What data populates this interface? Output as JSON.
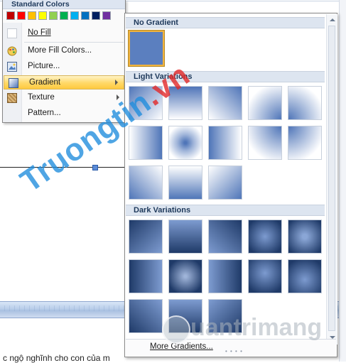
{
  "fill_menu": {
    "standard_colors_title": "Standard Colors",
    "standard_colors": [
      "#c00000",
      "#ff0000",
      "#ffc000",
      "#ffff00",
      "#92d050",
      "#00b050",
      "#00b0f0",
      "#0070c0",
      "#002060",
      "#7030a0"
    ],
    "items": [
      {
        "label": "No Fill",
        "icon": "no-fill-icon"
      },
      {
        "label": "More Fill Colors...",
        "icon": "palette-icon"
      },
      {
        "label": "Picture...",
        "icon": "picture-icon"
      },
      {
        "label": "Gradient",
        "icon": "gradient-icon",
        "highlighted": true,
        "submenu": true
      },
      {
        "label": "Texture",
        "icon": "texture-icon",
        "submenu": true
      },
      {
        "label": "Pattern...",
        "icon": "pattern-icon"
      }
    ]
  },
  "gradient_gallery": {
    "no_gradient_title": "No Gradient",
    "light_variations_title": "Light Variations",
    "dark_variations_title": "Dark Variations",
    "more_gradients_label": "More Gradients..."
  },
  "document": {
    "body_text": "c ngộ nghĩnh cho con của m"
  },
  "watermarks": {
    "left": "Truongtin",
    "left_suffix": ".vn",
    "right": "uantrimang"
  },
  "colors": {
    "accent_blue": "#4f75b8",
    "highlight": "#ffd867"
  }
}
